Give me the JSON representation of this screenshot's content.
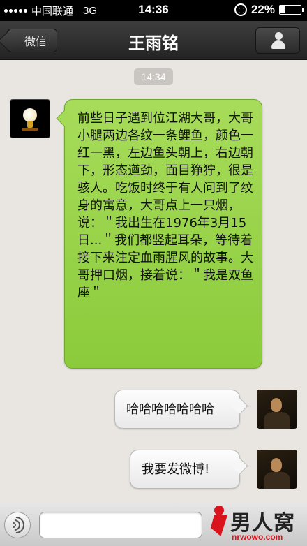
{
  "status_bar": {
    "carrier": "中国联通",
    "network": "3G",
    "time": "14:36",
    "battery": "22%",
    "battery_level": 0.22
  },
  "nav": {
    "back_label": "微信",
    "title": "王雨铭"
  },
  "chat": {
    "timestamp": "14:34",
    "messages": [
      {
        "sender": "friend",
        "text": "前些日子遇到位江湖大哥，大哥小腿两边各纹一条鲤鱼，颜色一红一黑，左边鱼头朝上，右边朝下，形态遒劲，面目狰狞，很是骇人。吃饭时终于有人问到了纹身的寓意，大哥点上一只烟，说：＂我出生在1976年3月15日...＂我们都竖起耳朵，等待着接下来注定血雨腥风的故事。大哥押口烟，接着说：＂我是双鱼座＂"
      },
      {
        "sender": "me",
        "text": "哈哈哈哈哈哈哈"
      },
      {
        "sender": "me",
        "text": "我要发微博!"
      }
    ]
  },
  "input": {
    "value": "",
    "placeholder": ""
  },
  "watermark": {
    "brand": "男人窝",
    "domain": "nrwowo.com",
    "brand_color": "#d9141c"
  },
  "colors": {
    "sent_bubble": "#8bcb3b",
    "received_bubble": "#f4f4f4",
    "nav_bar": "#2e2e2e"
  }
}
